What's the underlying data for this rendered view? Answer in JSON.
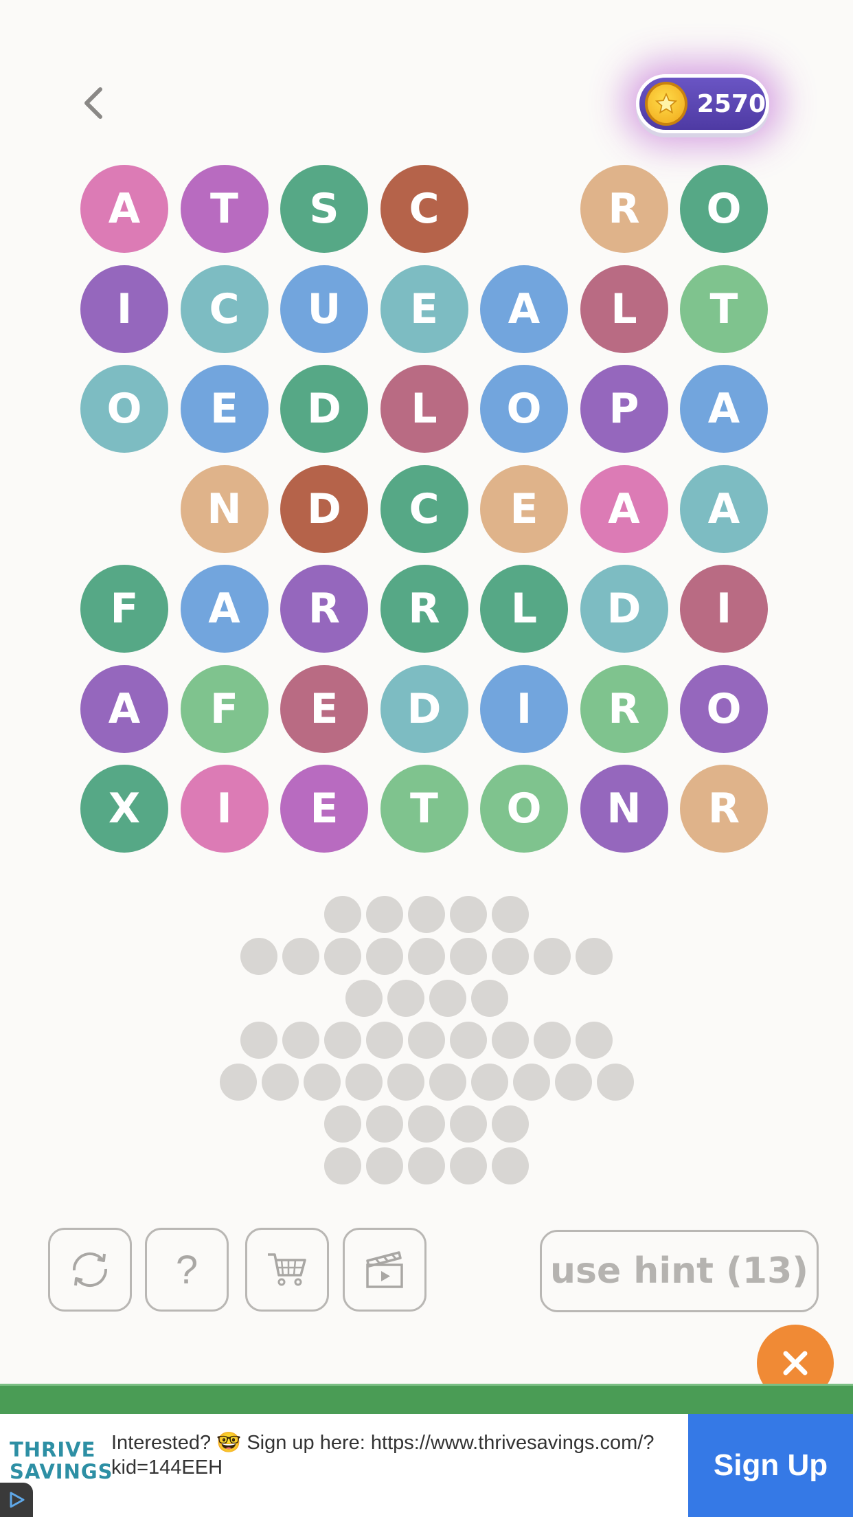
{
  "header": {
    "coin_count": "2570"
  },
  "board": {
    "rows": [
      [
        {
          "l": "A",
          "c": "#dc7bb5"
        },
        {
          "l": "T",
          "c": "#b86bc0"
        },
        {
          "l": "S",
          "c": "#56a886"
        },
        {
          "l": "C",
          "c": "#b5634a"
        },
        null,
        {
          "l": "R",
          "c": "#dfb38a"
        },
        {
          "l": "O",
          "c": "#56a886"
        }
      ],
      [
        {
          "l": "I",
          "c": "#9567bd"
        },
        {
          "l": "C",
          "c": "#7dbcc2"
        },
        {
          "l": "U",
          "c": "#72a5dd"
        },
        {
          "l": "E",
          "c": "#7dbcc2"
        },
        {
          "l": "A",
          "c": "#72a5dd"
        },
        {
          "l": "L",
          "c": "#b96b83"
        },
        {
          "l": "T",
          "c": "#7fc38e"
        }
      ],
      [
        {
          "l": "O",
          "c": "#7dbcc2"
        },
        {
          "l": "E",
          "c": "#72a5dd"
        },
        {
          "l": "D",
          "c": "#56a886"
        },
        {
          "l": "L",
          "c": "#b96b83"
        },
        {
          "l": "O",
          "c": "#72a5dd"
        },
        {
          "l": "P",
          "c": "#9567bd"
        },
        {
          "l": "A",
          "c": "#72a5dd"
        }
      ],
      [
        null,
        {
          "l": "N",
          "c": "#dfb38a"
        },
        {
          "l": "D",
          "c": "#b5634a"
        },
        {
          "l": "C",
          "c": "#56a886"
        },
        {
          "l": "E",
          "c": "#dfb38a"
        },
        {
          "l": "A",
          "c": "#dc7bb5"
        },
        {
          "l": "A",
          "c": "#7dbcc2"
        }
      ],
      [
        {
          "l": "F",
          "c": "#56a886"
        },
        {
          "l": "A",
          "c": "#72a5dd"
        },
        {
          "l": "R",
          "c": "#9567bd"
        },
        {
          "l": "R",
          "c": "#56a886"
        },
        {
          "l": "L",
          "c": "#56a886"
        },
        {
          "l": "D",
          "c": "#7dbcc2"
        },
        {
          "l": "I",
          "c": "#b96b83"
        }
      ],
      [
        {
          "l": "A",
          "c": "#9567bd"
        },
        {
          "l": "F",
          "c": "#7fc38e"
        },
        {
          "l": "E",
          "c": "#b96b83"
        },
        {
          "l": "D",
          "c": "#7dbcc2"
        },
        {
          "l": "I",
          "c": "#72a5dd"
        },
        {
          "l": "R",
          "c": "#7fc38e"
        },
        {
          "l": "O",
          "c": "#9567bd"
        }
      ],
      [
        {
          "l": "X",
          "c": "#56a886"
        },
        {
          "l": "I",
          "c": "#dc7bb5"
        },
        {
          "l": "E",
          "c": "#b86bc0"
        },
        {
          "l": "T",
          "c": "#7fc38e"
        },
        {
          "l": "O",
          "c": "#7fc38e"
        },
        {
          "l": "N",
          "c": "#9567bd"
        },
        {
          "l": "R",
          "c": "#dfb38a"
        }
      ]
    ]
  },
  "answer_word_lengths": [
    5,
    9,
    4,
    9,
    10,
    5,
    5
  ],
  "toolbar": {
    "shuffle_icon": "shuffle-icon",
    "help_label": "?",
    "cart_icon": "cart-icon",
    "video_icon": "video-clapper-icon",
    "hint_label": "use hint (13)"
  },
  "ad": {
    "logo_line1": "THRIVE",
    "logo_line2": "SAVINGS",
    "text": "Interested? 🤓 Sign up here: https://www.thrivesavings.com/?kid=144EEH",
    "cta": "Sign Up",
    "close_icon": "close-icon"
  },
  "colors": {
    "background": "#fbfaf8",
    "coin_pill": "#5a45b5",
    "ad_cta": "#3579e6",
    "close": "#f08a35"
  }
}
